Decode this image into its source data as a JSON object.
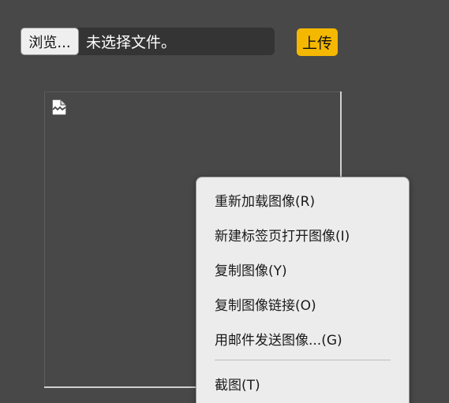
{
  "upload_form": {
    "browse_label": "浏览...",
    "file_status": "未选择文件。",
    "upload_label": "上传"
  },
  "image": {
    "icon": "broken-image-icon"
  },
  "context_menu": {
    "items": [
      {
        "label": "重新加载图像(R)"
      },
      {
        "label": "新建标签页打开图像(I)"
      },
      {
        "label": "复制图像(Y)"
      },
      {
        "label": "复制图像链接(O)"
      },
      {
        "label": "用邮件发送图像...(G)"
      },
      {
        "label": "截图(T)"
      }
    ]
  },
  "colors": {
    "background": "#484848",
    "upload_button": "#f5b800",
    "menu_background": "#ececec"
  }
}
